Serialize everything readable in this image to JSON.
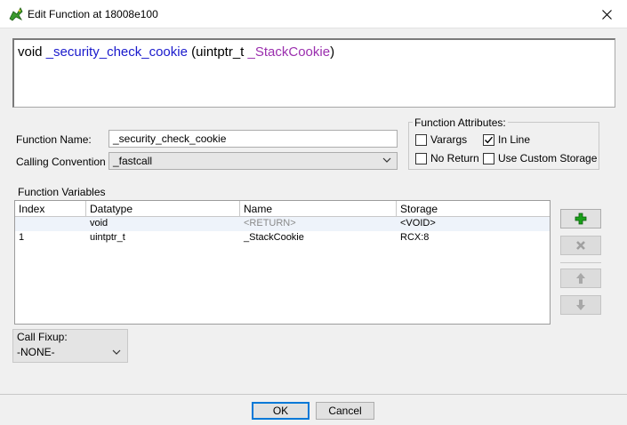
{
  "window": {
    "title": "Edit Function at 18008e100"
  },
  "signature": {
    "return_type": "void",
    "name": "_security_check_cookie",
    "open": "(",
    "param_type": "uintptr_t",
    "param_name": "_StackCookie",
    "close": ")"
  },
  "form": {
    "function_name_label": "Function Name:",
    "function_name_value": "_security_check_cookie",
    "calling_convention_label": "Calling Convention",
    "calling_convention_value": "_fastcall"
  },
  "attributes": {
    "legend": "Function Attributes:",
    "varargs": {
      "label": "Varargs",
      "checked": false
    },
    "inline": {
      "label": "In Line",
      "checked": true
    },
    "no_return": {
      "label": "No Return",
      "checked": false
    },
    "custom_storage": {
      "label": "Use Custom Storage",
      "checked": false
    }
  },
  "variables": {
    "label": "Function Variables",
    "columns": [
      "Index",
      "Datatype",
      "Name",
      "Storage"
    ],
    "rows": [
      {
        "index": "",
        "datatype": "void",
        "name": "<RETURN>",
        "storage": "<VOID>"
      },
      {
        "index": "1",
        "datatype": "uintptr_t",
        "name": "_StackCookie",
        "storage": "RCX:8"
      }
    ]
  },
  "side_buttons": {
    "add": "add-icon",
    "remove": "delete-icon",
    "up": "arrow-up-icon",
    "down": "arrow-down-icon"
  },
  "call_fixup": {
    "legend": "Call Fixup:",
    "value": "-NONE-"
  },
  "buttons": {
    "ok": "OK",
    "cancel": "Cancel"
  },
  "colors": {
    "accent": "#0078d7",
    "sig_blue": "#1a1acc",
    "sig_purple": "#9b2fae",
    "add_green": "#1aa01a"
  }
}
